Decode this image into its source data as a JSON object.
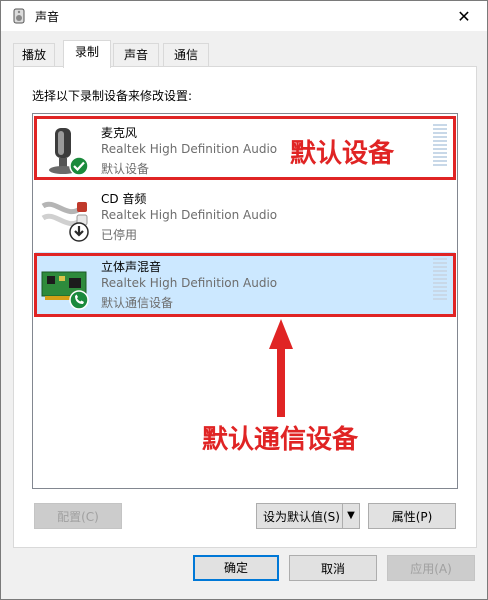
{
  "window": {
    "title": "声音",
    "close_glyph": "✕"
  },
  "tabs": [
    {
      "label": "播放"
    },
    {
      "label": "录制"
    },
    {
      "label": "声音"
    },
    {
      "label": "通信"
    }
  ],
  "instruction": "选择以下录制设备来修改设置:",
  "devices": [
    {
      "name": "麦克风",
      "description": "Realtek High Definition Audio",
      "status": "默认设备",
      "badge_icon": "check-icon",
      "badge_color": "#1b8a3c"
    },
    {
      "name": "CD 音频",
      "description": "Realtek High Definition Audio",
      "status": "已停用",
      "badge_icon": "down-arrow-icon",
      "badge_color": "#2b2b2b"
    },
    {
      "name": "立体声混音",
      "description": "Realtek High Definition Audio",
      "status": "默认通信设备",
      "badge_icon": "phone-icon",
      "badge_color": "#1b8a3c",
      "selected": true
    }
  ],
  "annotations": {
    "default_device": "默认设备",
    "default_comm_device": "默认通信设备",
    "color": "#e02424"
  },
  "buttons": {
    "configure": "配置(C)",
    "set_default": "设为默认值(S)",
    "properties": "属性(P)",
    "ok": "确定",
    "cancel": "取消",
    "apply": "应用(A)"
  }
}
